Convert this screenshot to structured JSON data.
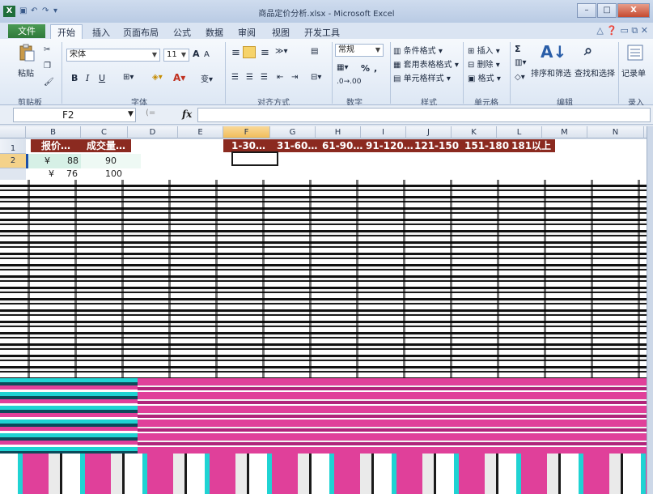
{
  "window": {
    "title": "商品定价分析.xlsx - Microsoft Excel",
    "app_icon": "X",
    "buttons": {
      "minimize": "–",
      "maximize": "□",
      "close": "X"
    }
  },
  "ribbon_tabs": {
    "file": "文件",
    "items": [
      "开始",
      "插入",
      "页面布局",
      "公式",
      "数据",
      "审阅",
      "视图",
      "开发工具"
    ]
  },
  "ribbon": {
    "clipboard": {
      "paste": "粘贴",
      "group": "剪贴板"
    },
    "font": {
      "name": "宋体",
      "size": "11",
      "bold": "B",
      "italic": "I",
      "underline": "U",
      "group": "字体"
    },
    "alignment": {
      "group": "对齐方式"
    },
    "number": {
      "format": "常规",
      "percent": "%",
      "group": "数字"
    },
    "styles": {
      "conditional": "条件格式",
      "table": "套用表格格式",
      "cell": "单元格样式",
      "group": "样式"
    },
    "cells": {
      "insert": "插入",
      "delete": "删除",
      "format": "格式",
      "group": "单元格"
    },
    "editing": {
      "sum": "Σ",
      "sort": "排序和筛选",
      "find": "查找和选择",
      "group": "编辑"
    },
    "record": {
      "label": "记录单",
      "group": "录入"
    }
  },
  "formula_bar": {
    "name_box": "F2",
    "fx": "fx"
  },
  "columns": [
    "B",
    "C",
    "D",
    "E",
    "F",
    "G",
    "H",
    "I",
    "J",
    "K",
    "L",
    "M",
    "N"
  ],
  "rows": [
    "1",
    "2"
  ],
  "sheet": {
    "b1": "报价…",
    "c1": "成交量…",
    "ranges": [
      "1-30…",
      "31-60…",
      "61-90…",
      "91-120…",
      "121-150",
      "151-180",
      "181以上"
    ],
    "b2_currency": "¥",
    "b2_value": "88",
    "c2": "90",
    "b3_currency": "¥",
    "b3_value": "76",
    "c3": "100"
  },
  "colors": {
    "header_fill": "#8b2a20",
    "selected_col": "#f1bd5a",
    "glitch_magenta": "#e0409a",
    "glitch_cyan": "#1fd3d3"
  }
}
